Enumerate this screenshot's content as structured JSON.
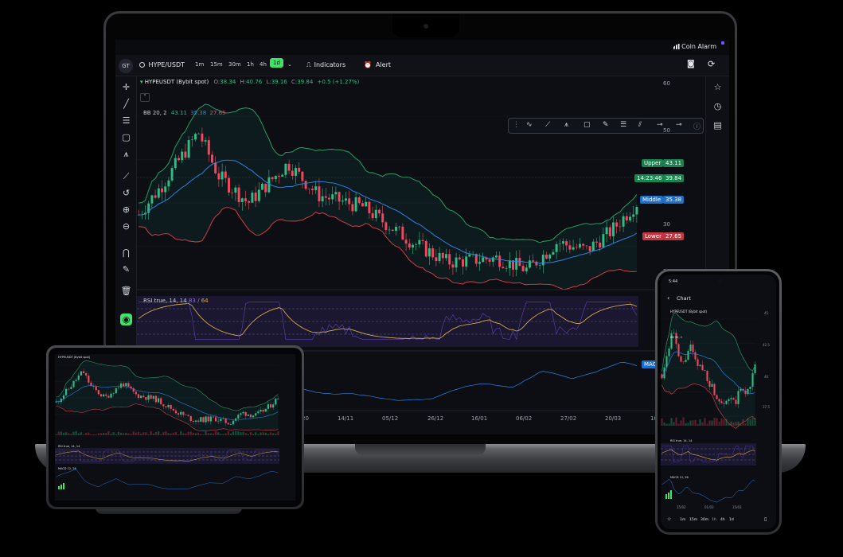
{
  "colors": {
    "up": "#2ebd85",
    "down": "#f6465d",
    "accent": "#3ee36a",
    "mid": "#2b86e8",
    "rsi": "#d8b24a",
    "rsi_band": "#2a1f4a",
    "upper": "#28a263",
    "lower": "#d33f49"
  },
  "laptop": {
    "menubar": {
      "app": "Coin Alarm"
    },
    "toolbar": {
      "avatar": "GT",
      "symbol": "HYPE/USDT",
      "timeframes": [
        "1m",
        "15m",
        "30m",
        "1h",
        "4h",
        "1d"
      ],
      "active_tf": "1d",
      "indicators": "Indicators",
      "alert": "Alert"
    },
    "legend": {
      "pair": "HYPEUSDT (Bybit spot)",
      "o_label": "O:",
      "o": "38.34",
      "h_label": "H:",
      "h": "40.76",
      "l_label": "L:",
      "l": "39.16",
      "c_label": "C:",
      "c": "39.84",
      "chg": "+0.5 (+1.27%)"
    },
    "bb": {
      "label": "BB 20, 2",
      "upper": "43.11",
      "middle": "35.38",
      "lower": "27.65"
    },
    "tags": {
      "upper_label": "Upper",
      "upper": "43.11",
      "time": "14:23:46",
      "price": "39.84",
      "middle_label": "Middle",
      "middle": "35.38",
      "lower_label": "Lower",
      "lower": "27.65"
    },
    "price_axis": [
      "60",
      "50",
      "40",
      "30",
      "20"
    ],
    "rsi": {
      "label": "RSI",
      "params": "true, 14, 14",
      "v1": "83",
      "sep": "/",
      "v2": "64"
    },
    "macd": {
      "label": "MAC"
    },
    "date_axis": [
      "20",
      "14/11",
      "05/12",
      "26/12",
      "16/01",
      "06/02",
      "27/02",
      "20/03",
      "10/"
    ]
  },
  "tablet": {
    "pair": "HYPEUSDT (Bybit spot)",
    "rsi": "RSI true, 14, 14",
    "macd": "MACD 12, 26"
  },
  "phone": {
    "status_time": "5:44",
    "title": "Chart",
    "pair": "HYPEUSDT (Bybit spot)",
    "bb": "BB 20, 2",
    "rsi": "RSI true, 14, 14",
    "macd": "MACD 12, 26",
    "axis": [
      "45",
      "42.5",
      "40",
      "37.5"
    ],
    "dates": [
      "15/02",
      "01/03",
      "15/03"
    ],
    "timeframes": [
      "1m",
      "15m",
      "30m",
      "1h",
      "4h",
      "1d"
    ],
    "active_tf": "1h"
  }
}
